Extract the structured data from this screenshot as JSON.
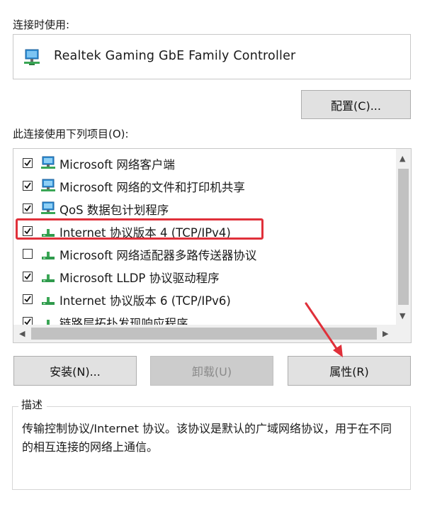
{
  "connect_using_label": "连接时使用:",
  "adapter": {
    "name": "Realtek Gaming GbE Family Controller",
    "icon": "network-adapter-icon"
  },
  "configure_button": "配置(C)...",
  "items_label": "此连接使用下列项目(O):",
  "items": [
    {
      "label": "Microsoft 网络客户端",
      "checked": true,
      "icon": "network-client-icon"
    },
    {
      "label": "Microsoft 网络的文件和打印机共享",
      "checked": true,
      "icon": "network-client-icon"
    },
    {
      "label": "QoS 数据包计划程序",
      "checked": true,
      "icon": "network-client-icon"
    },
    {
      "label": "Internet 协议版本 4 (TCP/IPv4)",
      "checked": true,
      "icon": "protocol-icon"
    },
    {
      "label": "Microsoft 网络适配器多路传送器协议",
      "checked": false,
      "icon": "protocol-icon"
    },
    {
      "label": "Microsoft LLDP 协议驱动程序",
      "checked": true,
      "icon": "protocol-icon"
    },
    {
      "label": "Internet 协议版本 6 (TCP/IPv6)",
      "checked": true,
      "icon": "protocol-icon"
    },
    {
      "label": "链路层拓扑发现响应程序",
      "checked": true,
      "icon": "protocol-icon"
    }
  ],
  "buttons": {
    "install": "安装(N)...",
    "uninstall": "卸载(U)",
    "properties": "属性(R)"
  },
  "description": {
    "title": "描述",
    "text": "传输控制协议/Internet 协议。该协议是默认的广域网络协议，用于在不同的相互连接的网络上通信。"
  },
  "colors": {
    "highlight": "#e0303a",
    "arrow": "#e0303a",
    "button_bg": "#e1e1e1"
  }
}
